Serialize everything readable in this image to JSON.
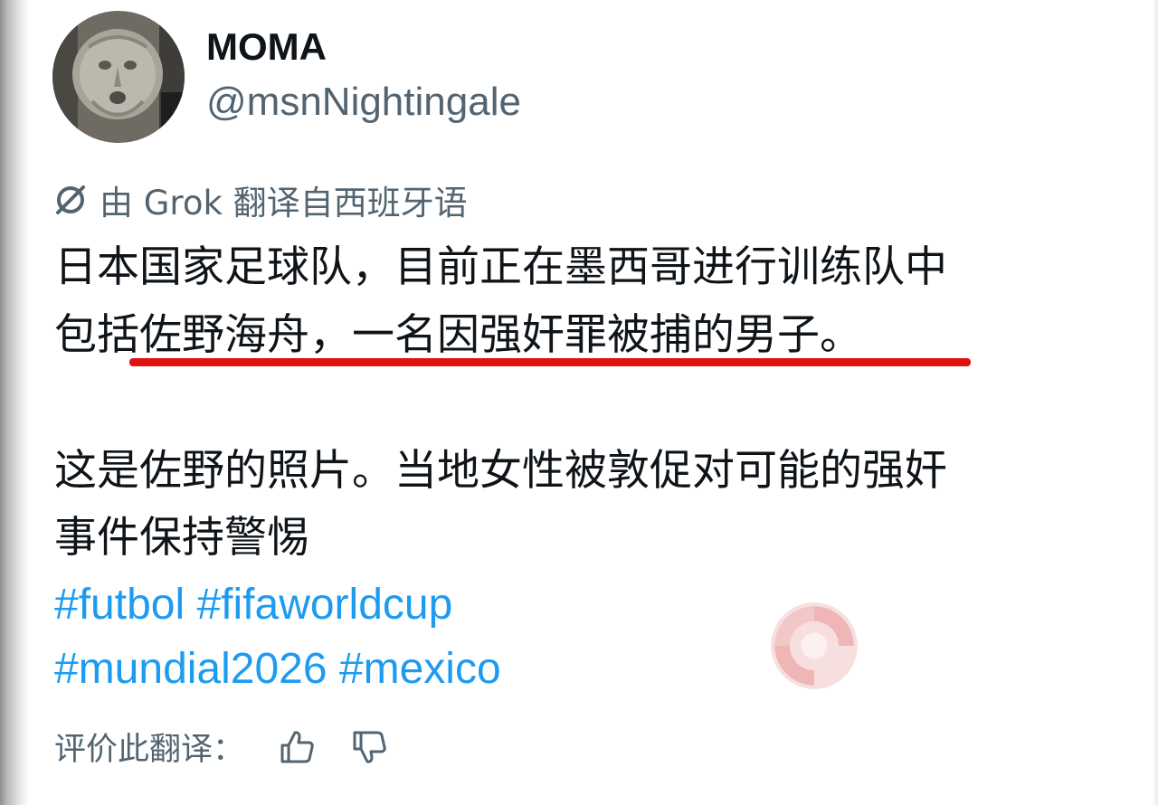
{
  "user": {
    "display_name": "MOMA",
    "handle": "@msnNightingale"
  },
  "translation_note": {
    "icon": "grok-icon",
    "text": "由 Grok 翻译自西班牙语"
  },
  "tweet": {
    "lines": [
      "日本国家足球队，目前正在墨西哥进行训练队中",
      "包括佐野海舟，一名因强奸罪被捕的男子。",
      "这是佐野的照片。当地女性被敦促对可能的强奸",
      "事件保持警惕"
    ],
    "highlight_color": "#e01111"
  },
  "hashtags": [
    "#futbol",
    "#fifaworldcup",
    "#mundial2026",
    "#mexico"
  ],
  "rate": {
    "label": "评价此翻译：",
    "thumbs_up_icon": "thumbs-up-icon",
    "thumbs_down_icon": "thumbs-down-icon"
  },
  "colors": {
    "text": "#0f1419",
    "secondary": "#536471",
    "link": "#1d9bf0"
  }
}
